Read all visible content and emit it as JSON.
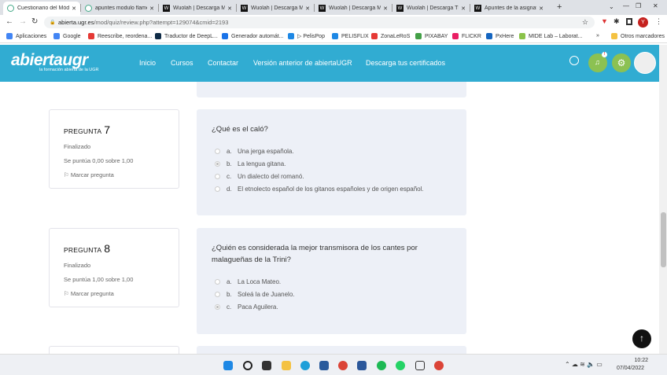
{
  "browser": {
    "tabs": [
      {
        "title": "Cuestionario del Módulo",
        "active": true
      },
      {
        "title": "apuntes modulo flamenco"
      },
      {
        "title": "Wuolah | Descarga Mo"
      },
      {
        "title": "Wuolah | Descarga Mo"
      },
      {
        "title": "Wuolah | Descarga Mo"
      },
      {
        "title": "Wuolah | Descarga TE"
      },
      {
        "title": "Apuntes de la asignatura"
      }
    ],
    "new_tab": "+",
    "url_domain": "abierta.ugr.es",
    "url_path": "/mod/quiz/review.php?attempt=129074&cmid=2193",
    "profile_initial": "Y",
    "bookmarks": [
      "Aplicaciones",
      "Google",
      "Reescribe, reordena...",
      "Traductor de DeepL...",
      "Generador automát...",
      "▷ PelisPop",
      "PELISFLIX",
      "ZonaLeRoS",
      "PIXABAY",
      "FLICKR",
      "PxHere",
      "MIDE Lab – Laborat..."
    ],
    "other_bookmarks": "Otros marcadores"
  },
  "site": {
    "logo": "abiertaugr",
    "logo_tagline": "la formación abierta de la UGR",
    "nav": [
      "Inicio",
      "Cursos",
      "Contactar",
      "Versión anterior de abiertaUGR",
      "Descarga tus certificados"
    ],
    "notification_badge": "!",
    "accent": "#31acd2"
  },
  "questions": [
    {
      "label": "PREGUNTA",
      "number": "7",
      "state": "Finalizado",
      "score": "Se puntúa 0,00 sobre 1,00",
      "flag": "Marcar pregunta",
      "text": "¿Qué es el caló?",
      "options": [
        {
          "k": "a.",
          "t": "Una jerga española."
        },
        {
          "k": "b.",
          "t": "La lengua gitana.",
          "selected": true
        },
        {
          "k": "c.",
          "t": "Un dialecto del romanó."
        },
        {
          "k": "d.",
          "t": "El etnolecto español de los gitanos españoles y de origen español."
        }
      ]
    },
    {
      "label": "PREGUNTA",
      "number": "8",
      "state": "Finalizado",
      "score": "Se puntúa 1,00 sobre 1,00",
      "flag": "Marcar pregunta",
      "text": "¿Quién es considerada la mejor transmisora de los cantes por malagueñas de la Trini?",
      "options": [
        {
          "k": "a.",
          "t": "La Loca Mateo."
        },
        {
          "k": "b.",
          "t": "Soleá la de Juanelo."
        },
        {
          "k": "c.",
          "t": "Paca Aguilera.",
          "selected": true
        }
      ]
    }
  ],
  "taskbar": {
    "time": "10:22",
    "date": "07/04/2022"
  }
}
